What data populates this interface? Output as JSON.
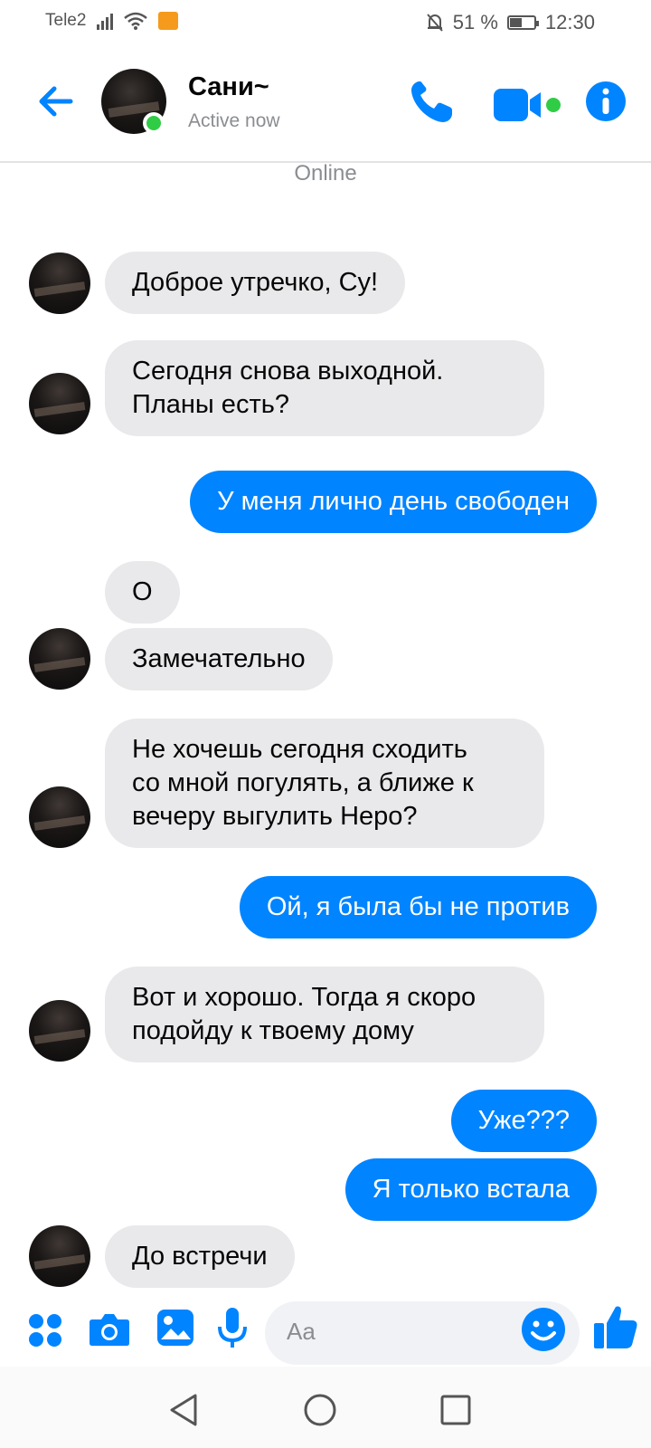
{
  "status_bar": {
    "carrier": "Tele2",
    "battery_percent": "51 %",
    "battery_level": 0.51,
    "time": "12:30"
  },
  "header": {
    "contact_name": "Сани~",
    "contact_status": "Active now",
    "icons": [
      "back-arrow-icon",
      "phone-icon",
      "video-camera-icon",
      "info-icon"
    ]
  },
  "online_label": "Online",
  "messages": [
    {
      "from": "contact",
      "text": "Доброе утречко, Су!"
    },
    {
      "from": "contact",
      "text": "Сегодня снова выходной.\nПланы есть?"
    },
    {
      "from": "me",
      "text": "У меня лично день свободен"
    },
    {
      "from": "contact",
      "text": "О"
    },
    {
      "from": "contact",
      "text": "Замечательно"
    },
    {
      "from": "contact",
      "text": "Не хочешь сегодня сходить\nсо мной погулять, а ближе к\nвечеру выгулить Неро?"
    },
    {
      "from": "me",
      "text": "Ой, я была бы не против"
    },
    {
      "from": "contact",
      "text": "Вот и хорошо. Тогда я скоро\nподойду к твоему дому"
    },
    {
      "from": "me",
      "text": "Уже???"
    },
    {
      "from": "me",
      "text": "Я только встала"
    },
    {
      "from": "contact",
      "text": "До встречи"
    }
  ],
  "composer": {
    "placeholder": "Aa",
    "icons": [
      "apps-icon",
      "camera-icon",
      "gallery-icon",
      "microphone-icon",
      "emoji-icon",
      "thumbs-up-icon"
    ]
  },
  "colors": {
    "accent": "#0084ff",
    "incoming_bubble": "#e9e9eb",
    "online_green": "#31cc46"
  }
}
